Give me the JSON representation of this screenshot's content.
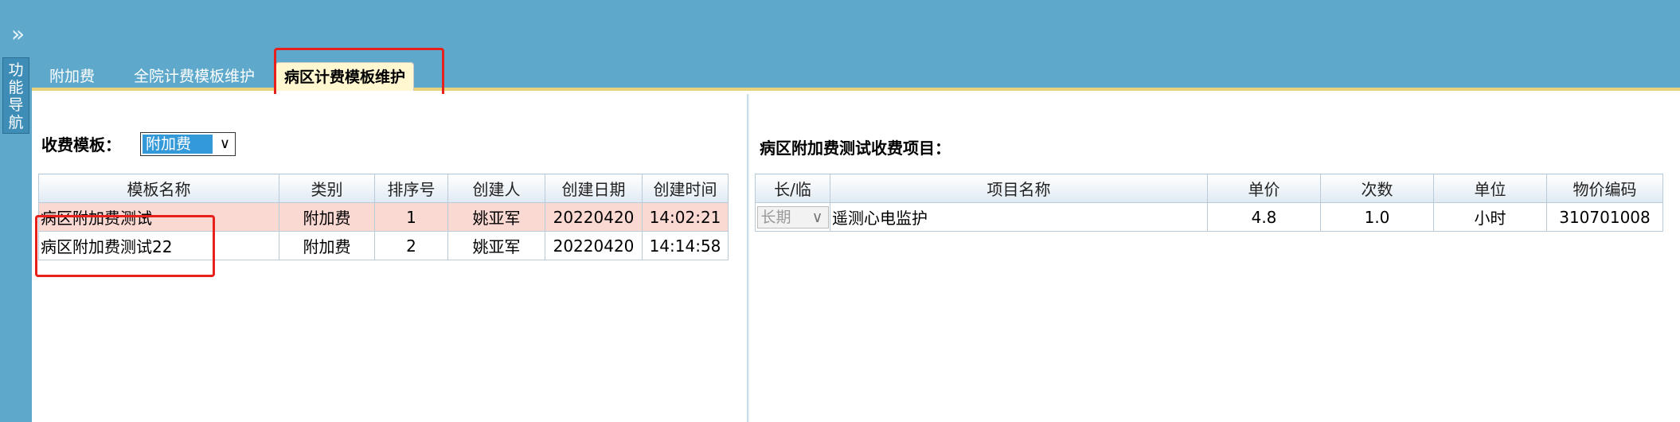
{
  "topbar": {
    "expand_icon": "»"
  },
  "sidebar": {
    "nav_tab_chars": [
      "功",
      "能",
      "导",
      "航"
    ]
  },
  "tabs": [
    {
      "label": "附加费",
      "active": false
    },
    {
      "label": "全院计费模板维护",
      "active": false
    },
    {
      "label": "病区计费模板维护",
      "active": true
    }
  ],
  "left": {
    "template_label": "收费模板：",
    "template_select": {
      "value": "附加费",
      "chevron": "∨"
    },
    "columns": [
      "模板名称",
      "类别",
      "排序号",
      "创建人",
      "创建日期",
      "创建时间"
    ],
    "rows": [
      [
        "病区附加费测试",
        "附加费",
        "1",
        "姚亚军",
        "20220420",
        "14:02:21"
      ],
      [
        "病区附加费测试22",
        "附加费",
        "2",
        "姚亚军",
        "20220420",
        "14:14:58"
      ]
    ]
  },
  "right": {
    "title": "病区附加费测试收费项目：",
    "columns": [
      "长/临",
      "项目名称",
      "单价",
      "次数",
      "单位",
      "物价编码"
    ],
    "rows": [
      {
        "type": "长期",
        "name": "遥测心电监护",
        "price": "4.8",
        "count": "1.0",
        "unit": "小时",
        "code": "310701008"
      }
    ],
    "type_chevron": "∨"
  },
  "colors": {
    "accent": "#5ea9cb",
    "highlight": "#e8201b",
    "selected_row": "#fbd9d3",
    "active_tab": "#fff7cf"
  }
}
